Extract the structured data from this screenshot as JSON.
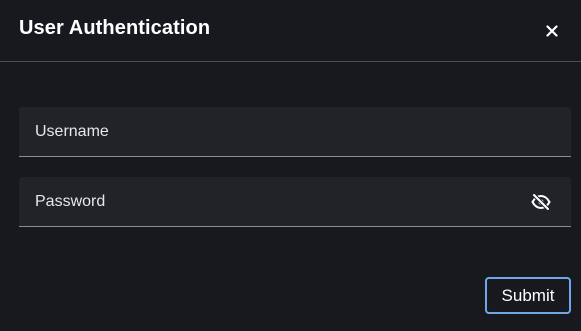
{
  "dialog": {
    "title": "User Authentication",
    "close_icon": "close-icon"
  },
  "form": {
    "username": {
      "label": "Username",
      "value": ""
    },
    "password": {
      "label": "Password",
      "value": "",
      "visibility_icon": "eye-slash-icon"
    },
    "submit_label": "Submit"
  },
  "colors": {
    "background": "#17191e",
    "field_background": "#212328",
    "field_underline": "#8a8d93",
    "divider": "#4a4d54",
    "submit_border": "#6fa8e8",
    "text": "#ffffff"
  }
}
